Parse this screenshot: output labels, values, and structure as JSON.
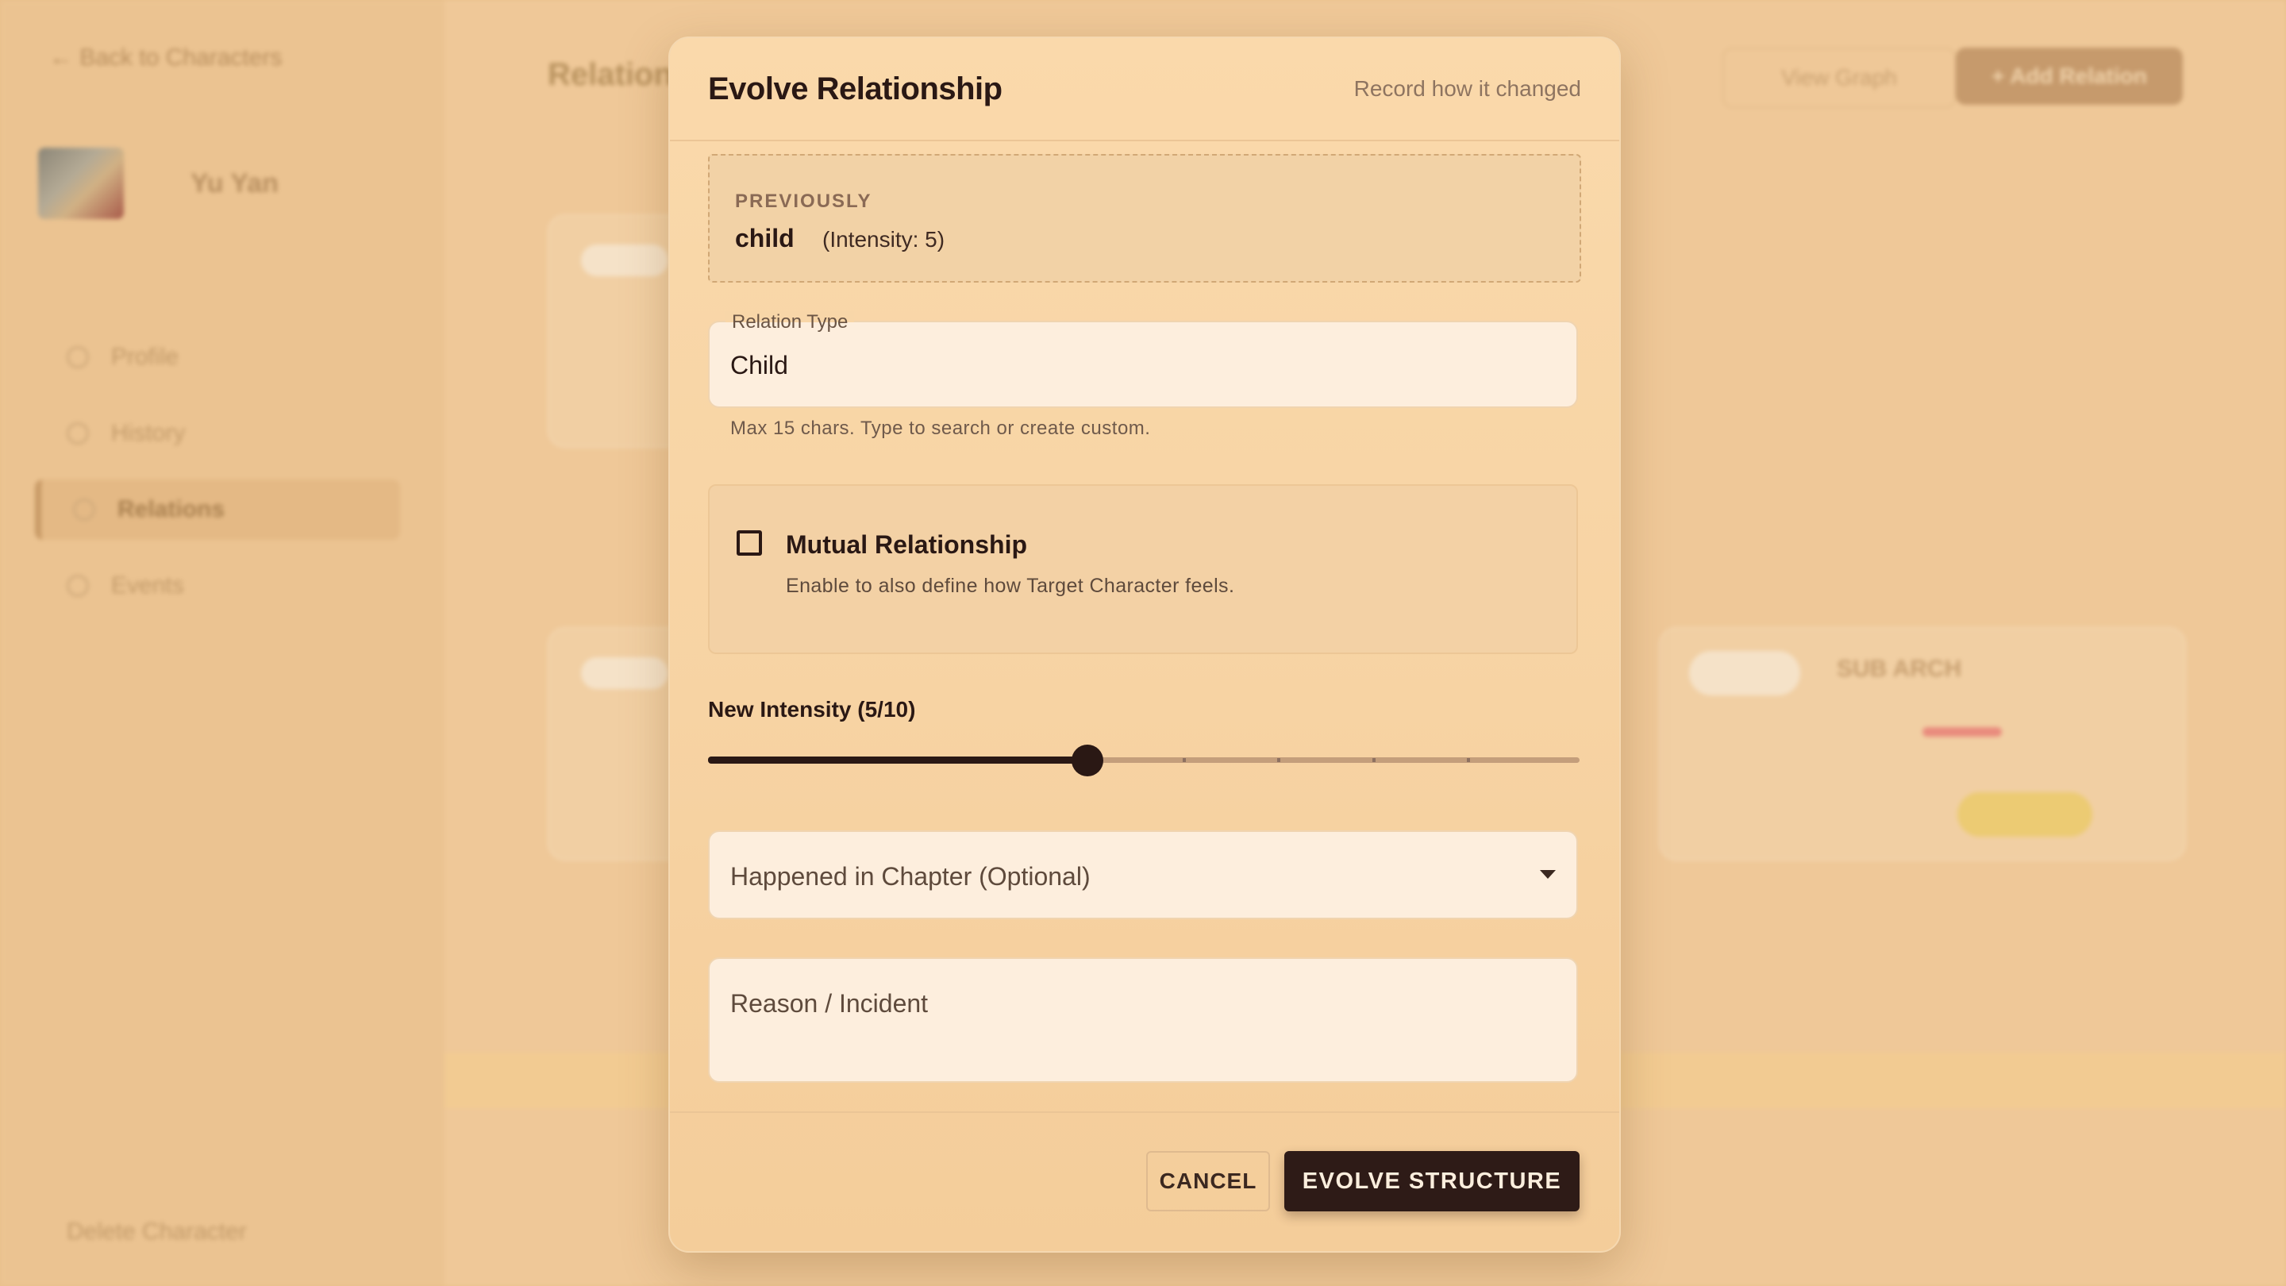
{
  "background": {
    "back_link": "← Back to Characters",
    "character": {
      "name": "Yu Yan"
    },
    "nav": [
      "Profile",
      "History",
      "Relations",
      "Events"
    ],
    "delete_label": "Delete Character",
    "page_title": "Relations",
    "view_graph_label": "View Graph",
    "add_relation_label": "+ Add Relation",
    "card_name": "SUB ARCH"
  },
  "modal": {
    "title": "Evolve Relationship",
    "subtitle": "Record how it changed",
    "previously": {
      "label": "PREVIOUSLY",
      "relation": "child",
      "intensity_text": "(Intensity: 5)"
    },
    "relation_type": {
      "label": "Relation Type",
      "value": "Child",
      "helper": "Max 15 chars. Type to search or create custom."
    },
    "mutual": {
      "label": "Mutual Relationship",
      "description": "Enable to also define how Target Character feels.",
      "checked": false
    },
    "intensity": {
      "label": "New Intensity (5/10)",
      "value": 5,
      "min": 1,
      "max": 10
    },
    "chapter": {
      "placeholder": "Happened in Chapter (Optional)"
    },
    "reason": {
      "placeholder": "Reason / Incident"
    },
    "buttons": {
      "cancel": "CANCEL",
      "submit": "EVOLVE STRUCTURE"
    }
  },
  "colors": {
    "accent_dark": "#2e1b17",
    "modal_bg": "#f8d6a8",
    "backdrop": "#e9c08c"
  }
}
